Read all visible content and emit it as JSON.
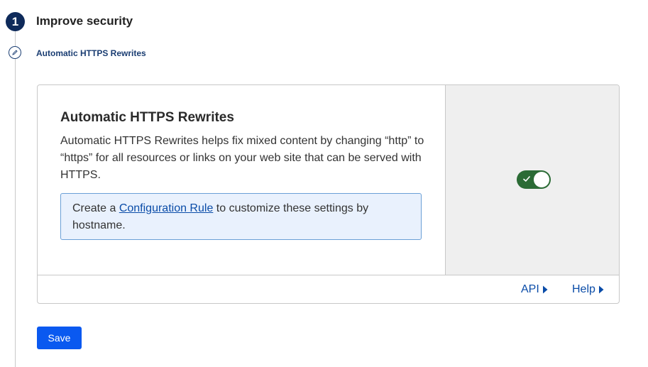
{
  "step": {
    "number": "1",
    "title": "Improve security"
  },
  "substep": {
    "title": "Automatic HTTPS Rewrites",
    "icon": "pencil-icon"
  },
  "setting": {
    "title": "Automatic HTTPS Rewrites",
    "description": "Automatic HTTPS Rewrites helps fix mixed content by changing “http” to “https” for all resources or links on your web site that can be served with HTTPS.",
    "info": {
      "prefix": "Create a ",
      "link_label": "Configuration Rule",
      "suffix": " to customize these settings by hostname."
    },
    "toggle": {
      "state": "on",
      "icon": "check-icon",
      "color": "#2b6b35"
    }
  },
  "footer": {
    "api_label": "API",
    "help_label": "Help"
  },
  "actions": {
    "save_label": "Save"
  },
  "colors": {
    "accent": "#0a59f0",
    "link": "#0a4ca8",
    "step_circle": "#0e2a5a"
  }
}
